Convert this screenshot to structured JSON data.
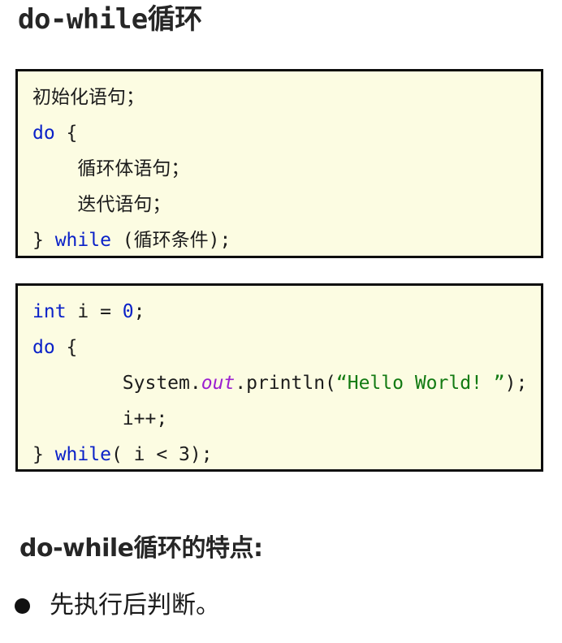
{
  "slide": {
    "title": "do-while循环"
  },
  "code_block_1": {
    "name": "do-while-syntax-template",
    "lines": [
      {
        "id": "l1",
        "segments": [
          {
            "text": "初始化语句；",
            "style": "plain"
          }
        ]
      },
      {
        "id": "l2",
        "segments": [
          {
            "text": "do",
            "style": "kw"
          },
          {
            "text": " {",
            "style": "plain"
          }
        ]
      },
      {
        "id": "l3",
        "segments": [
          {
            "text": "    循环体语句；",
            "style": "plain"
          }
        ]
      },
      {
        "id": "l4",
        "segments": [
          {
            "text": "    迭代语句；",
            "style": "plain"
          }
        ]
      },
      {
        "id": "l5",
        "segments": [
          {
            "text": "} ",
            "style": "plain"
          },
          {
            "text": "while",
            "style": "kw"
          },
          {
            "text": " (循环条件);",
            "style": "plain"
          }
        ]
      }
    ]
  },
  "code_block_2": {
    "name": "do-while-example-java",
    "lines": [
      {
        "id": "m1",
        "segments": [
          {
            "text": "int",
            "style": "kw"
          },
          {
            "text": " i = ",
            "style": "plain"
          },
          {
            "text": "0",
            "style": "num"
          },
          {
            "text": ";",
            "style": "plain"
          }
        ]
      },
      {
        "id": "m2",
        "segments": [
          {
            "text": "do",
            "style": "kw"
          },
          {
            "text": " {",
            "style": "plain"
          }
        ]
      },
      {
        "id": "m3",
        "segments": [
          {
            "text": "        System.",
            "style": "plain"
          },
          {
            "text": "out",
            "style": "field"
          },
          {
            "text": ".println(",
            "style": "plain"
          },
          {
            "text": "“Hello World! ”",
            "style": "str"
          },
          {
            "text": ");",
            "style": "plain"
          }
        ]
      },
      {
        "id": "m4",
        "segments": [
          {
            "text": "        i++;",
            "style": "plain"
          }
        ]
      },
      {
        "id": "m5",
        "segments": [
          {
            "text": "} ",
            "style": "plain"
          },
          {
            "text": "while",
            "style": "kw"
          },
          {
            "text": "( ",
            "style": "plain"
          },
          {
            "text": "i",
            "style": "plain",
            "squiggle": true
          },
          {
            "text": " < 3);",
            "style": "plain"
          }
        ]
      }
    ]
  },
  "features": {
    "heading": "do-while循环的特点:",
    "items": [
      "先执行后判断。"
    ]
  },
  "colors": {
    "code_background": "#fcfce2",
    "code_border": "#0d0d0d",
    "keyword": "#0a21c8",
    "string": "#127a12",
    "field": "#9b1fd0",
    "text": "#1c1c1c",
    "squiggle": "#e02020"
  }
}
